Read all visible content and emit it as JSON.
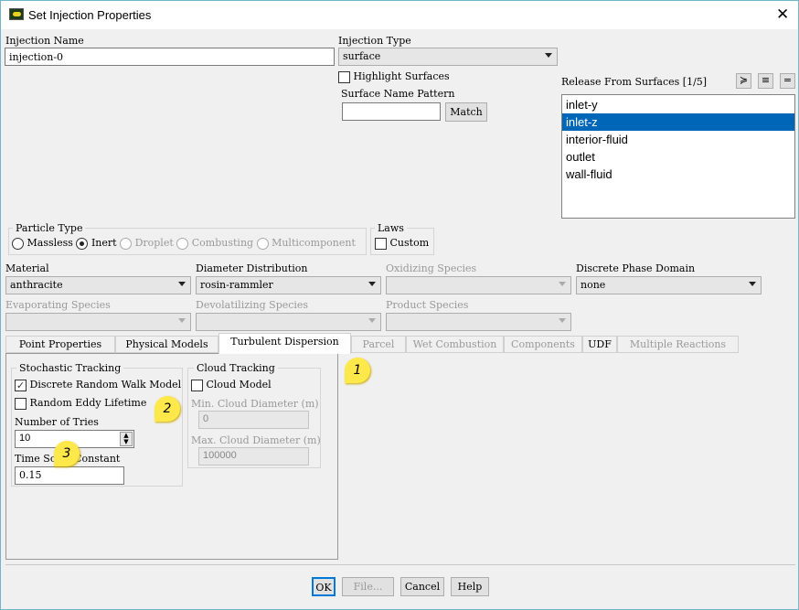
{
  "window": {
    "title": "Set Injection Properties",
    "close_icon": "close-icon"
  },
  "injection_name": {
    "label": "Injection Name",
    "value": "injection-0"
  },
  "injection_type": {
    "label": "Injection Type",
    "value": "surface"
  },
  "highlight_surfaces": {
    "label": "Highlight Surfaces",
    "checked": false
  },
  "surface_name_pattern": {
    "label": "Surface Name Pattern",
    "value": "",
    "match_label": "Match"
  },
  "release_from_surfaces": {
    "label": "Release From Surfaces [1/5]",
    "items": [
      "inlet-y",
      "inlet-z",
      "interior-fluid",
      "outlet",
      "wall-fluid"
    ],
    "selected": "inlet-z"
  },
  "particle_type": {
    "label": "Particle Type",
    "options": [
      "Massless",
      "Inert",
      "Droplet",
      "Combusting",
      "Multicomponent"
    ],
    "selected": "Inert"
  },
  "laws": {
    "label": "Laws",
    "custom_label": "Custom"
  },
  "material": {
    "label": "Material",
    "value": "anthracite"
  },
  "diameter_distribution": {
    "label": "Diameter Distribution",
    "value": "rosin-rammler"
  },
  "oxidizing_species": {
    "label": "Oxidizing Species"
  },
  "discrete_phase_domain": {
    "label": "Discrete Phase Domain",
    "value": "none"
  },
  "evaporating_species": {
    "label": "Evaporating Species"
  },
  "devolatilizing_species": {
    "label": "Devolatilizing Species"
  },
  "product_species": {
    "label": "Product Species"
  },
  "tabs": [
    "Point Properties",
    "Physical Models",
    "Turbulent Dispersion",
    "Parcel",
    "Wet Combustion",
    "Components",
    "UDF",
    "Multiple Reactions"
  ],
  "active_tab": "Turbulent Dispersion",
  "stochastic": {
    "label": "Stochastic Tracking",
    "drw_label": "Discrete Random Walk Model",
    "drw_checked": true,
    "rel_label": "Random Eddy Lifetime",
    "rel_checked": false,
    "tries_label": "Number of Tries",
    "tries_value": "10",
    "tsc_label": "Time Scale Constant",
    "tsc_value": "0.15"
  },
  "cloud": {
    "label": "Cloud Tracking",
    "model_label": "Cloud Model",
    "min_label": "Min. Cloud Diameter (m)",
    "min_value": "0",
    "max_label": "Max. Cloud Diameter (m)",
    "max_value": "100000"
  },
  "markers": [
    "1",
    "2",
    "3"
  ],
  "buttons": {
    "ok": "OK",
    "file": "File...",
    "cancel": "Cancel",
    "help": "Help"
  },
  "colors": {
    "selection": "#0066b8",
    "marker": "#ffe84a"
  }
}
